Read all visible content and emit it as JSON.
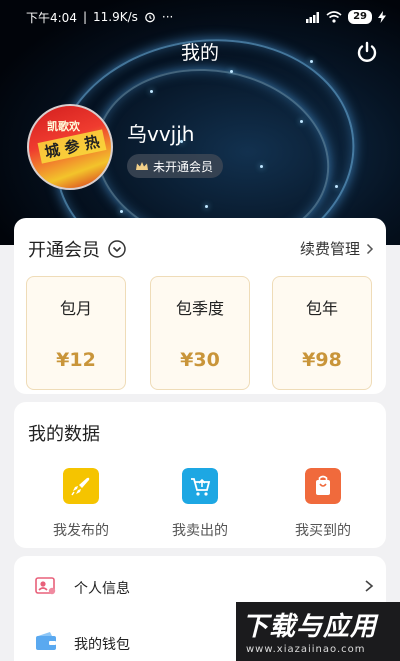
{
  "status_bar": {
    "time": "下午4:04",
    "net_speed": "11.9K/s",
    "more": "···",
    "battery": "29"
  },
  "header": {
    "title": "我的",
    "username": "乌vvjjh",
    "member_badge": "未开通会员"
  },
  "avatar": {
    "line1": "凯歌欢",
    "line2": "城 参 热"
  },
  "vip": {
    "title": "开通会员",
    "renew_label": "续费管理",
    "plans": [
      {
        "name": "包月",
        "price": "¥12"
      },
      {
        "name": "包季度",
        "price": "¥30"
      },
      {
        "name": "包年",
        "price": "¥98"
      }
    ]
  },
  "my_data": {
    "title": "我的数据",
    "items": [
      {
        "label": "我发布的",
        "icon": "rocket-icon",
        "color": "#f5c400"
      },
      {
        "label": "我卖出的",
        "icon": "cart-upload-icon",
        "color": "#1da7e3"
      },
      {
        "label": "我买到的",
        "icon": "shopping-bag-icon",
        "color": "#f06a3c"
      }
    ]
  },
  "menu": {
    "items": [
      {
        "label": "个人信息",
        "icon": "profile-card-icon"
      },
      {
        "label": "我的钱包",
        "icon": "wallet-icon"
      }
    ]
  },
  "watermark": {
    "main": "下载与应用",
    "sub": "www.xiazaiinao.com"
  },
  "colors": {
    "price": "#c9953a",
    "header_bg": "#061424",
    "page_bg": "#f1f1f3"
  }
}
